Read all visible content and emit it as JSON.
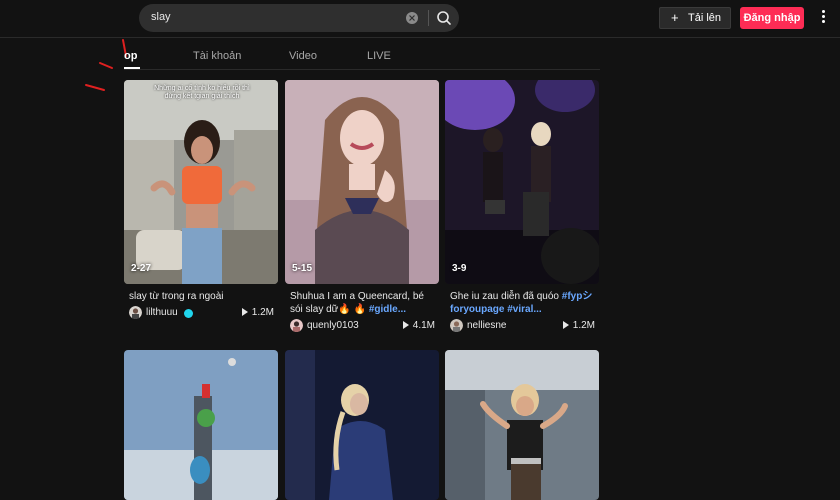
{
  "search": {
    "query": "slay"
  },
  "header": {
    "upload_label": "Tải lên",
    "login_label": "Đăng nhập"
  },
  "tabs": [
    {
      "label": "op",
      "active": true
    },
    {
      "label": "Tài khoản",
      "active": false
    },
    {
      "label": "Video",
      "active": false
    },
    {
      "label": "LIVE",
      "active": false
    }
  ],
  "videos": [
    {
      "date": "2-27",
      "overlay": "Những ai cố tình ko hiểu rồi thì đừng kết tgian giải thích",
      "caption": "slay từ trong ra ngoài",
      "author": "lilthuuu",
      "verified": true,
      "plays": "1.2M"
    },
    {
      "date": "5-15",
      "caption": "Shuhua I am a Queencard, bé sói slay dữ🔥 🔥 ",
      "tags": "#gidle...",
      "author": "quenly0103",
      "verified": false,
      "plays": "4.1M"
    },
    {
      "date": "3-9",
      "caption": "Ghe iu zau diễn đã quóo ",
      "tags": "#fypシforyoupage #viral...",
      "author": "nelliesne",
      "verified": false,
      "plays": "1.2M"
    }
  ],
  "colors": {
    "accent": "#fe2c55",
    "hashtag": "#6aa8ff",
    "background": "#121212"
  }
}
